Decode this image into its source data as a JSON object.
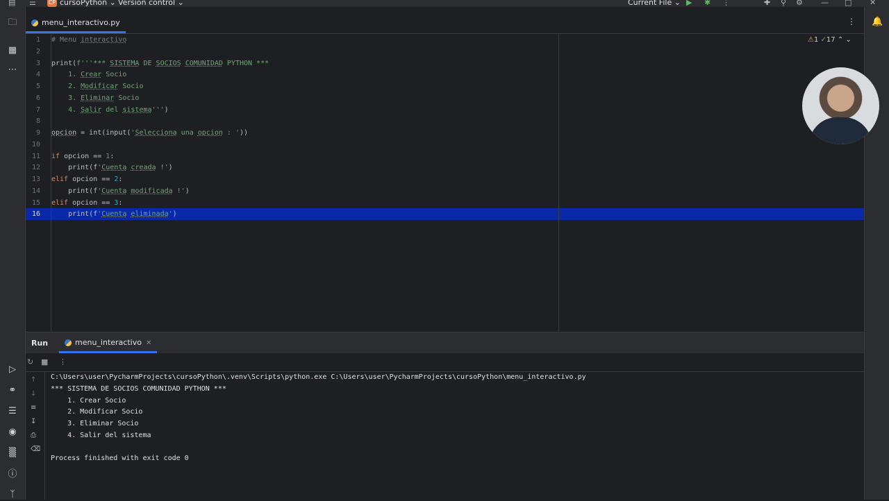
{
  "titlebar": {
    "project": "cursoPython",
    "project_badge": "CP",
    "vcs": "Version control",
    "run_config": "Current File"
  },
  "editor": {
    "tab_label": "menu_interactivo.py",
    "inspections": {
      "warnings": "1",
      "ok": "17"
    },
    "lines": [
      {
        "n": "1",
        "segs": [
          {
            "t": "# Menu ",
            "c": "cm"
          },
          {
            "t": "interactivo",
            "c": "cm ul"
          }
        ]
      },
      {
        "n": "2",
        "segs": []
      },
      {
        "n": "3",
        "segs": [
          {
            "t": "print(",
            "c": "fn"
          },
          {
            "t": "f'''*** ",
            "c": "str"
          },
          {
            "t": "SISTEMA",
            "c": "str ul"
          },
          {
            "t": " DE ",
            "c": "str"
          },
          {
            "t": "SOCIOS",
            "c": "str ul"
          },
          {
            "t": " ",
            "c": "str"
          },
          {
            "t": "COMUNIDAD",
            "c": "str ul"
          },
          {
            "t": " PYTHON ***",
            "c": "str"
          }
        ]
      },
      {
        "n": "4",
        "segs": [
          {
            "t": "    1. ",
            "c": "str"
          },
          {
            "t": "Crear",
            "c": "str ul"
          },
          {
            "t": " Socio",
            "c": "str"
          }
        ]
      },
      {
        "n": "5",
        "segs": [
          {
            "t": "    2. ",
            "c": "str"
          },
          {
            "t": "Modificar",
            "c": "str ul"
          },
          {
            "t": " Socio",
            "c": "str"
          }
        ]
      },
      {
        "n": "6",
        "segs": [
          {
            "t": "    3. ",
            "c": "str"
          },
          {
            "t": "Eliminar",
            "c": "str ul"
          },
          {
            "t": " Socio",
            "c": "str"
          }
        ]
      },
      {
        "n": "7",
        "segs": [
          {
            "t": "    4. ",
            "c": "str"
          },
          {
            "t": "Salir",
            "c": "str ul"
          },
          {
            "t": " del ",
            "c": "str"
          },
          {
            "t": "sistema",
            "c": "str ul"
          },
          {
            "t": "'''",
            "c": "str"
          },
          {
            "t": ")",
            "c": "fn"
          }
        ]
      },
      {
        "n": "8",
        "segs": []
      },
      {
        "n": "9",
        "segs": [
          {
            "t": "opcion",
            "c": "fn ul"
          },
          {
            "t": " = int(input(",
            "c": "fn"
          },
          {
            "t": "'",
            "c": "str"
          },
          {
            "t": "Selecciona",
            "c": "str ul"
          },
          {
            "t": " una ",
            "c": "str"
          },
          {
            "t": "opcion",
            "c": "str ul"
          },
          {
            "t": " : '",
            "c": "str"
          },
          {
            "t": "))",
            "c": "fn"
          }
        ]
      },
      {
        "n": "10",
        "segs": []
      },
      {
        "n": "11",
        "segs": [
          {
            "t": "if",
            "c": "kw"
          },
          {
            "t": " opcion == ",
            "c": "fn"
          },
          {
            "t": "1",
            "c": "num"
          },
          {
            "t": ":",
            "c": "fn"
          }
        ]
      },
      {
        "n": "12",
        "segs": [
          {
            "t": "    print(f",
            "c": "fn"
          },
          {
            "t": "'",
            "c": "str"
          },
          {
            "t": "Cuenta",
            "c": "str ul"
          },
          {
            "t": " ",
            "c": "str"
          },
          {
            "t": "creada",
            "c": "str ul"
          },
          {
            "t": " !'",
            "c": "str"
          },
          {
            "t": ")",
            "c": "fn"
          }
        ]
      },
      {
        "n": "13",
        "segs": [
          {
            "t": "elif",
            "c": "kw"
          },
          {
            "t": " opcion == ",
            "c": "fn"
          },
          {
            "t": "2",
            "c": "num"
          },
          {
            "t": ":",
            "c": "fn"
          }
        ]
      },
      {
        "n": "14",
        "segs": [
          {
            "t": "    print(f",
            "c": "fn"
          },
          {
            "t": "'",
            "c": "str"
          },
          {
            "t": "Cuenta",
            "c": "str ul"
          },
          {
            "t": " ",
            "c": "str"
          },
          {
            "t": "modificada",
            "c": "str ul"
          },
          {
            "t": " !'",
            "c": "str"
          },
          {
            "t": ")",
            "c": "fn"
          }
        ]
      },
      {
        "n": "15",
        "segs": [
          {
            "t": "elif",
            "c": "kw"
          },
          {
            "t": " opcion == ",
            "c": "fn"
          },
          {
            "t": "3",
            "c": "num"
          },
          {
            "t": ":",
            "c": "fn"
          }
        ]
      },
      {
        "n": "16",
        "segs": [
          {
            "t": "    print(f",
            "c": "fn"
          },
          {
            "t": "'",
            "c": "str"
          },
          {
            "t": "Cuenta",
            "c": "str ul"
          },
          {
            "t": " ",
            "c": "str"
          },
          {
            "t": "eliminada",
            "c": "str ul"
          },
          {
            "t": "'",
            "c": "str"
          },
          {
            "t": ")",
            "c": "fn"
          }
        ]
      }
    ]
  },
  "run": {
    "label": "Run",
    "tab_label": "menu_interactivo",
    "output": [
      "C:\\Users\\user\\PycharmProjects\\cursoPython\\.venv\\Scripts\\python.exe C:\\Users\\user\\PycharmProjects\\cursoPython\\menu_interactivo.py",
      "*** SISTEMA DE SOCIOS COMUNIDAD PYTHON ***",
      "    1. Crear Socio",
      "    2. Modificar Socio",
      "    3. Eliminar Socio",
      "    4. Salir del sistema",
      "",
      "Process finished with exit code 0"
    ]
  },
  "colors": {
    "accent": "#3574f0",
    "current_line": "#0a29a8",
    "string": "#6aab73",
    "keyword": "#cf8e6d",
    "number": "#2aacb8"
  }
}
